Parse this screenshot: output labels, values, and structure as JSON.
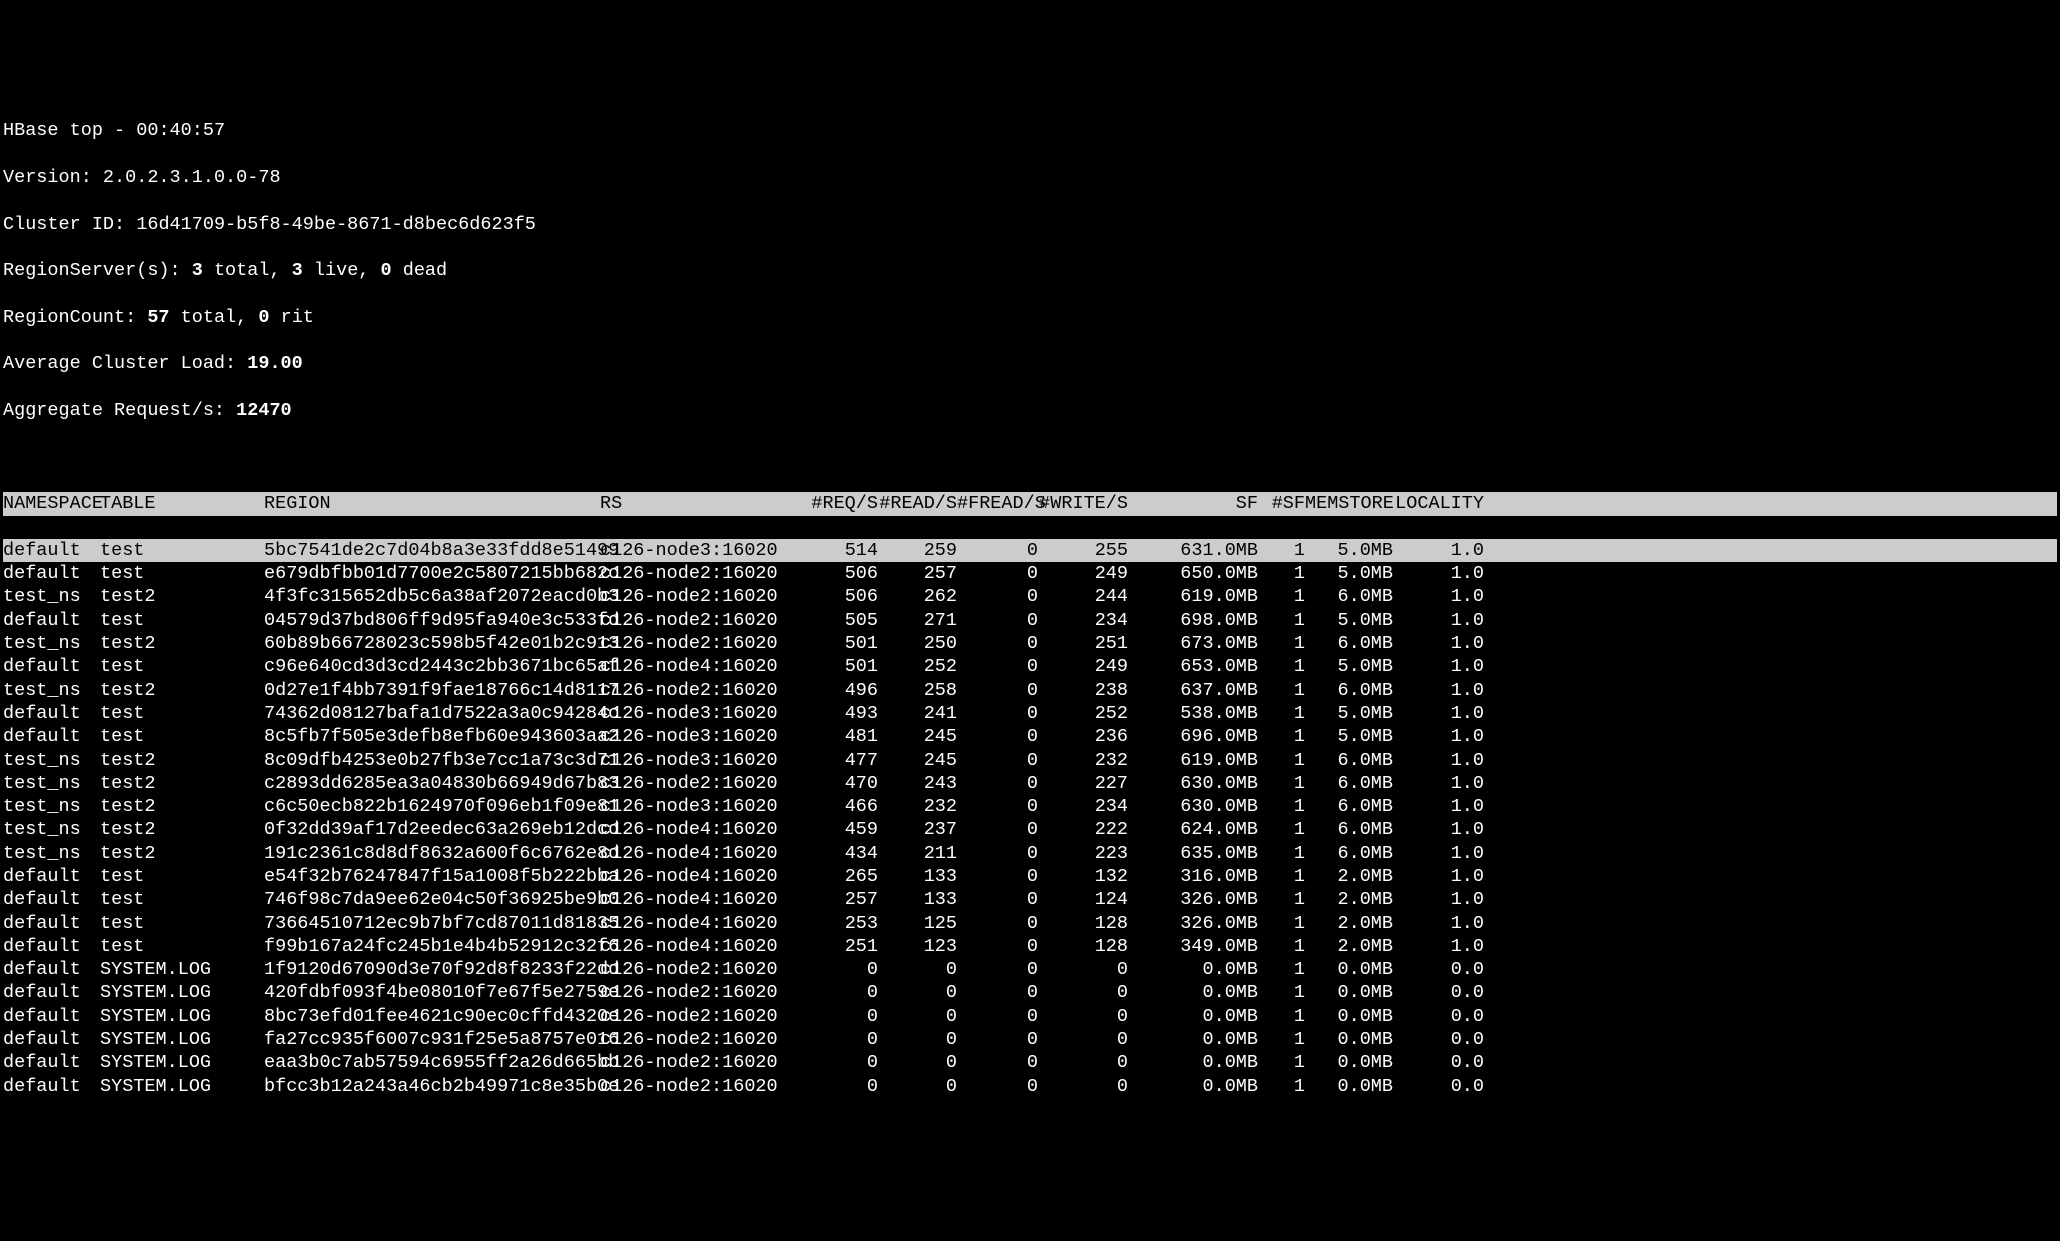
{
  "header": {
    "title_prefix": "HBase top - ",
    "time": "00:40:57",
    "version_label": "Version: ",
    "version": "2.0.2.3.1.0.0-78",
    "cluster_id_label": "Cluster ID: ",
    "cluster_id": "16d41709-b5f8-49be-8671-d8bec6d623f5",
    "regionserver_label": "RegionServer(s): ",
    "rs_total": "3",
    "rs_total_suffix": " total, ",
    "rs_live": "3",
    "rs_live_suffix": " live, ",
    "rs_dead": "0",
    "rs_dead_suffix": " dead",
    "regioncount_label": "RegionCount: ",
    "rc_total": "57",
    "rc_total_suffix": " total, ",
    "rc_rit": "0",
    "rc_rit_suffix": " rit",
    "avg_load_label": "Average Cluster Load: ",
    "avg_load": "19.00",
    "agg_req_label": "Aggregate Request/s: ",
    "agg_req": "12470"
  },
  "columns": {
    "namespace": "NAMESPACE",
    "table": "TABLE",
    "region": "REGION",
    "rs": "RS",
    "reqs": "#REQ/S",
    "reads": "#READ/S",
    "freads": "#FREAD/S",
    "writes": "#WRITE/S",
    "sf": "SF",
    "nsf": "#SF",
    "memstore": "MEMSTORE",
    "locality": "LOCALITY"
  },
  "rows": [
    {
      "namespace": "default",
      "table": "test",
      "region": "5bc7541de2c7d04b8a3e33fdd8e51499",
      "rs": "c126-node3:16020",
      "reqs": "514",
      "reads": "259",
      "freads": "0",
      "writes": "255",
      "sf": "631.0MB",
      "nsf": "1",
      "memstore": "5.0MB",
      "locality": "1.0",
      "selected": true
    },
    {
      "namespace": "default",
      "table": "test",
      "region": "e679dbfbb01d7700e2c5807215bb682c",
      "rs": "c126-node2:16020",
      "reqs": "506",
      "reads": "257",
      "freads": "0",
      "writes": "249",
      "sf": "650.0MB",
      "nsf": "1",
      "memstore": "5.0MB",
      "locality": "1.0"
    },
    {
      "namespace": "test_ns",
      "table": "test2",
      "region": "4f3fc315652db5c6a38af2072eacd0b3",
      "rs": "c126-node2:16020",
      "reqs": "506",
      "reads": "262",
      "freads": "0",
      "writes": "244",
      "sf": "619.0MB",
      "nsf": "1",
      "memstore": "6.0MB",
      "locality": "1.0"
    },
    {
      "namespace": "default",
      "table": "test",
      "region": "04579d37bd806ff9d95fa940e3c533fd",
      "rs": "c126-node2:16020",
      "reqs": "505",
      "reads": "271",
      "freads": "0",
      "writes": "234",
      "sf": "698.0MB",
      "nsf": "1",
      "memstore": "5.0MB",
      "locality": "1.0"
    },
    {
      "namespace": "test_ns",
      "table": "test2",
      "region": "60b89b66728023c598b5f42e01b2c913",
      "rs": "c126-node2:16020",
      "reqs": "501",
      "reads": "250",
      "freads": "0",
      "writes": "251",
      "sf": "673.0MB",
      "nsf": "1",
      "memstore": "6.0MB",
      "locality": "1.0"
    },
    {
      "namespace": "default",
      "table": "test",
      "region": "c96e640cd3d3cd2443c2bb3671bc65af",
      "rs": "c126-node4:16020",
      "reqs": "501",
      "reads": "252",
      "freads": "0",
      "writes": "249",
      "sf": "653.0MB",
      "nsf": "1",
      "memstore": "5.0MB",
      "locality": "1.0"
    },
    {
      "namespace": "test_ns",
      "table": "test2",
      "region": "0d27e1f4bb7391f9fae18766c14d8117",
      "rs": "c126-node2:16020",
      "reqs": "496",
      "reads": "258",
      "freads": "0",
      "writes": "238",
      "sf": "637.0MB",
      "nsf": "1",
      "memstore": "6.0MB",
      "locality": "1.0"
    },
    {
      "namespace": "default",
      "table": "test",
      "region": "74362d08127bafa1d7522a3a0c94284c",
      "rs": "c126-node3:16020",
      "reqs": "493",
      "reads": "241",
      "freads": "0",
      "writes": "252",
      "sf": "538.0MB",
      "nsf": "1",
      "memstore": "5.0MB",
      "locality": "1.0"
    },
    {
      "namespace": "default",
      "table": "test",
      "region": "8c5fb7f505e3defb8efb60e943603aa2",
      "rs": "c126-node3:16020",
      "reqs": "481",
      "reads": "245",
      "freads": "0",
      "writes": "236",
      "sf": "696.0MB",
      "nsf": "1",
      "memstore": "5.0MB",
      "locality": "1.0"
    },
    {
      "namespace": "test_ns",
      "table": "test2",
      "region": "8c09dfb4253e0b27fb3e7cc1a73c3d71",
      "rs": "c126-node3:16020",
      "reqs": "477",
      "reads": "245",
      "freads": "0",
      "writes": "232",
      "sf": "619.0MB",
      "nsf": "1",
      "memstore": "6.0MB",
      "locality": "1.0"
    },
    {
      "namespace": "test_ns",
      "table": "test2",
      "region": "c2893dd6285ea3a04830b66949d67b83",
      "rs": "c126-node2:16020",
      "reqs": "470",
      "reads": "243",
      "freads": "0",
      "writes": "227",
      "sf": "630.0MB",
      "nsf": "1",
      "memstore": "6.0MB",
      "locality": "1.0"
    },
    {
      "namespace": "test_ns",
      "table": "test2",
      "region": "c6c50ecb822b1624970f096eb1f09e81",
      "rs": "c126-node3:16020",
      "reqs": "466",
      "reads": "232",
      "freads": "0",
      "writes": "234",
      "sf": "630.0MB",
      "nsf": "1",
      "memstore": "6.0MB",
      "locality": "1.0"
    },
    {
      "namespace": "test_ns",
      "table": "test2",
      "region": "0f32dd39af17d2eedec63a269eb12dcd",
      "rs": "c126-node4:16020",
      "reqs": "459",
      "reads": "237",
      "freads": "0",
      "writes": "222",
      "sf": "624.0MB",
      "nsf": "1",
      "memstore": "6.0MB",
      "locality": "1.0"
    },
    {
      "namespace": "test_ns",
      "table": "test2",
      "region": "191c2361c8d8df8632a600f6c6762e8d",
      "rs": "c126-node4:16020",
      "reqs": "434",
      "reads": "211",
      "freads": "0",
      "writes": "223",
      "sf": "635.0MB",
      "nsf": "1",
      "memstore": "6.0MB",
      "locality": "1.0"
    },
    {
      "namespace": "default",
      "table": "test",
      "region": "e54f32b76247847f15a1008f5b222bba",
      "rs": "c126-node4:16020",
      "reqs": "265",
      "reads": "133",
      "freads": "0",
      "writes": "132",
      "sf": "316.0MB",
      "nsf": "1",
      "memstore": "2.0MB",
      "locality": "1.0"
    },
    {
      "namespace": "default",
      "table": "test",
      "region": "746f98c7da9ee62e04c50f36925be9b0",
      "rs": "c126-node4:16020",
      "reqs": "257",
      "reads": "133",
      "freads": "0",
      "writes": "124",
      "sf": "326.0MB",
      "nsf": "1",
      "memstore": "2.0MB",
      "locality": "1.0"
    },
    {
      "namespace": "default",
      "table": "test",
      "region": "73664510712ec9b7bf7cd87011d81835",
      "rs": "c126-node4:16020",
      "reqs": "253",
      "reads": "125",
      "freads": "0",
      "writes": "128",
      "sf": "326.0MB",
      "nsf": "1",
      "memstore": "2.0MB",
      "locality": "1.0"
    },
    {
      "namespace": "default",
      "table": "test",
      "region": "f99b167a24fc245b1e4b4b52912c32f6",
      "rs": "c126-node4:16020",
      "reqs": "251",
      "reads": "123",
      "freads": "0",
      "writes": "128",
      "sf": "349.0MB",
      "nsf": "1",
      "memstore": "2.0MB",
      "locality": "1.0"
    },
    {
      "namespace": "default",
      "table": "SYSTEM.LOG",
      "region": "1f9120d67090d3e70f92d8f8233f22dd",
      "rs": "c126-node2:16020",
      "reqs": "0",
      "reads": "0",
      "freads": "0",
      "writes": "0",
      "sf": "0.0MB",
      "nsf": "1",
      "memstore": "0.0MB",
      "locality": "0.0"
    },
    {
      "namespace": "default",
      "table": "SYSTEM.LOG",
      "region": "420fdbf093f4be08010f7e67f5e2759e",
      "rs": "c126-node2:16020",
      "reqs": "0",
      "reads": "0",
      "freads": "0",
      "writes": "0",
      "sf": "0.0MB",
      "nsf": "1",
      "memstore": "0.0MB",
      "locality": "0.0"
    },
    {
      "namespace": "default",
      "table": "SYSTEM.LOG",
      "region": "8bc73efd01fee4621c90ec0cffd4320e",
      "rs": "c126-node2:16020",
      "reqs": "0",
      "reads": "0",
      "freads": "0",
      "writes": "0",
      "sf": "0.0MB",
      "nsf": "1",
      "memstore": "0.0MB",
      "locality": "0.0"
    },
    {
      "namespace": "default",
      "table": "SYSTEM.LOG",
      "region": "fa27cc935f6007c931f25e5a8757e016",
      "rs": "c126-node2:16020",
      "reqs": "0",
      "reads": "0",
      "freads": "0",
      "writes": "0",
      "sf": "0.0MB",
      "nsf": "1",
      "memstore": "0.0MB",
      "locality": "0.0"
    },
    {
      "namespace": "default",
      "table": "SYSTEM.LOG",
      "region": "eaa3b0c7ab57594c6955ff2a26d665bb",
      "rs": "c126-node2:16020",
      "reqs": "0",
      "reads": "0",
      "freads": "0",
      "writes": "0",
      "sf": "0.0MB",
      "nsf": "1",
      "memstore": "0.0MB",
      "locality": "0.0"
    },
    {
      "namespace": "default",
      "table": "SYSTEM.LOG",
      "region": "bfcc3b12a243a46cb2b49971c8e35b0e",
      "rs": "c126-node2:16020",
      "reqs": "0",
      "reads": "0",
      "freads": "0",
      "writes": "0",
      "sf": "0.0MB",
      "nsf": "1",
      "memstore": "0.0MB",
      "locality": "0.0"
    }
  ]
}
